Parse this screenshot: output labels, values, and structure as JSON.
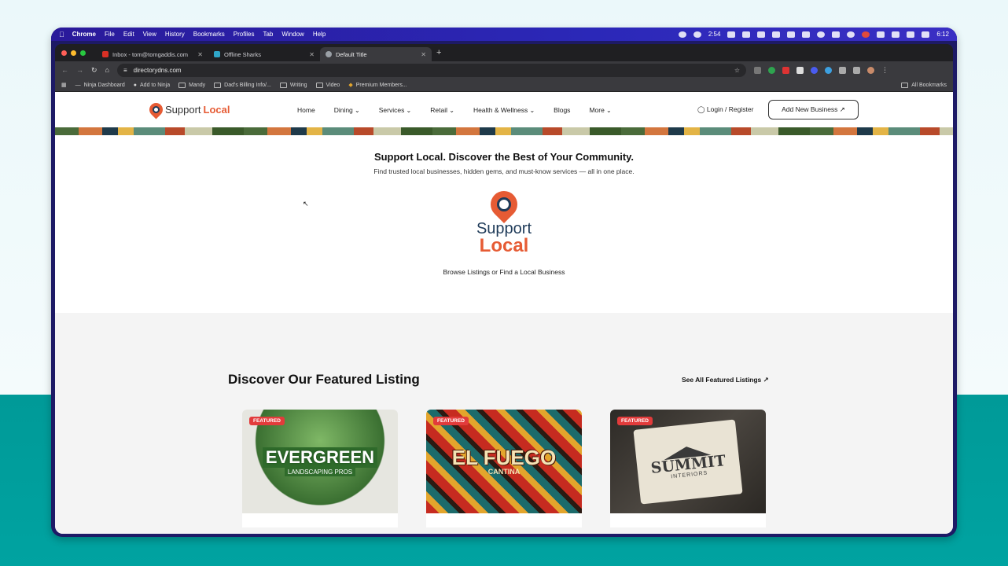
{
  "menubar": {
    "items": [
      "Chrome",
      "File",
      "Edit",
      "View",
      "History",
      "Bookmarks",
      "Profiles",
      "Tab",
      "Window",
      "Help"
    ],
    "timer": "2:54",
    "clock": "6:12"
  },
  "tabs": [
    {
      "label": "Inbox - tom@tomgaddis.com",
      "favicon_color": "#d93025"
    },
    {
      "label": "Offline Sharks",
      "favicon_color": "#2fa6c8"
    },
    {
      "label": "Default Title",
      "favicon_color": "#9aa0a6"
    }
  ],
  "omnibox": {
    "url": "directorydns.com"
  },
  "bookmarks": {
    "items": [
      "Ninja Dashboard",
      "Add to Ninja",
      "Mandy",
      "Dad's Billing Info/...",
      "Writing",
      "Video",
      "Premium Members..."
    ],
    "all": "All Bookmarks"
  },
  "site": {
    "logo_prefix": "Support",
    "logo_suffix": "Local",
    "nav": [
      "Home",
      "Dining",
      "Services",
      "Retail",
      "Health & Wellness",
      "Blogs",
      "More"
    ],
    "login": "Login / Register",
    "add_business": "Add New Business ↗"
  },
  "hero": {
    "title": "Support Local. Discover the Best of Your Community.",
    "subtitle": "Find trusted local businesses, hidden gems, and must-know services — all in one place.",
    "logo_line1": "Support",
    "logo_line2": "Local",
    "browse": "Browse Listings or Find a Local Business"
  },
  "featured": {
    "heading": "Discover Our Featured Listing",
    "see_all": "See All Featured Listings ↗",
    "badge": "FEATURED",
    "cards": [
      {
        "main": "EVERGREEN",
        "sub": "LANDSCAPING PROS"
      },
      {
        "main": "EL FUEGO",
        "sub": "CANTINA"
      },
      {
        "main": "SUMMIT",
        "sub": "INTERIORS"
      }
    ]
  },
  "colors": {
    "brand_orange": "#e65b34",
    "brand_navy": "#1f3b59",
    "badge_red": "#e23b3b",
    "teal_bg": "#00a3a1"
  }
}
